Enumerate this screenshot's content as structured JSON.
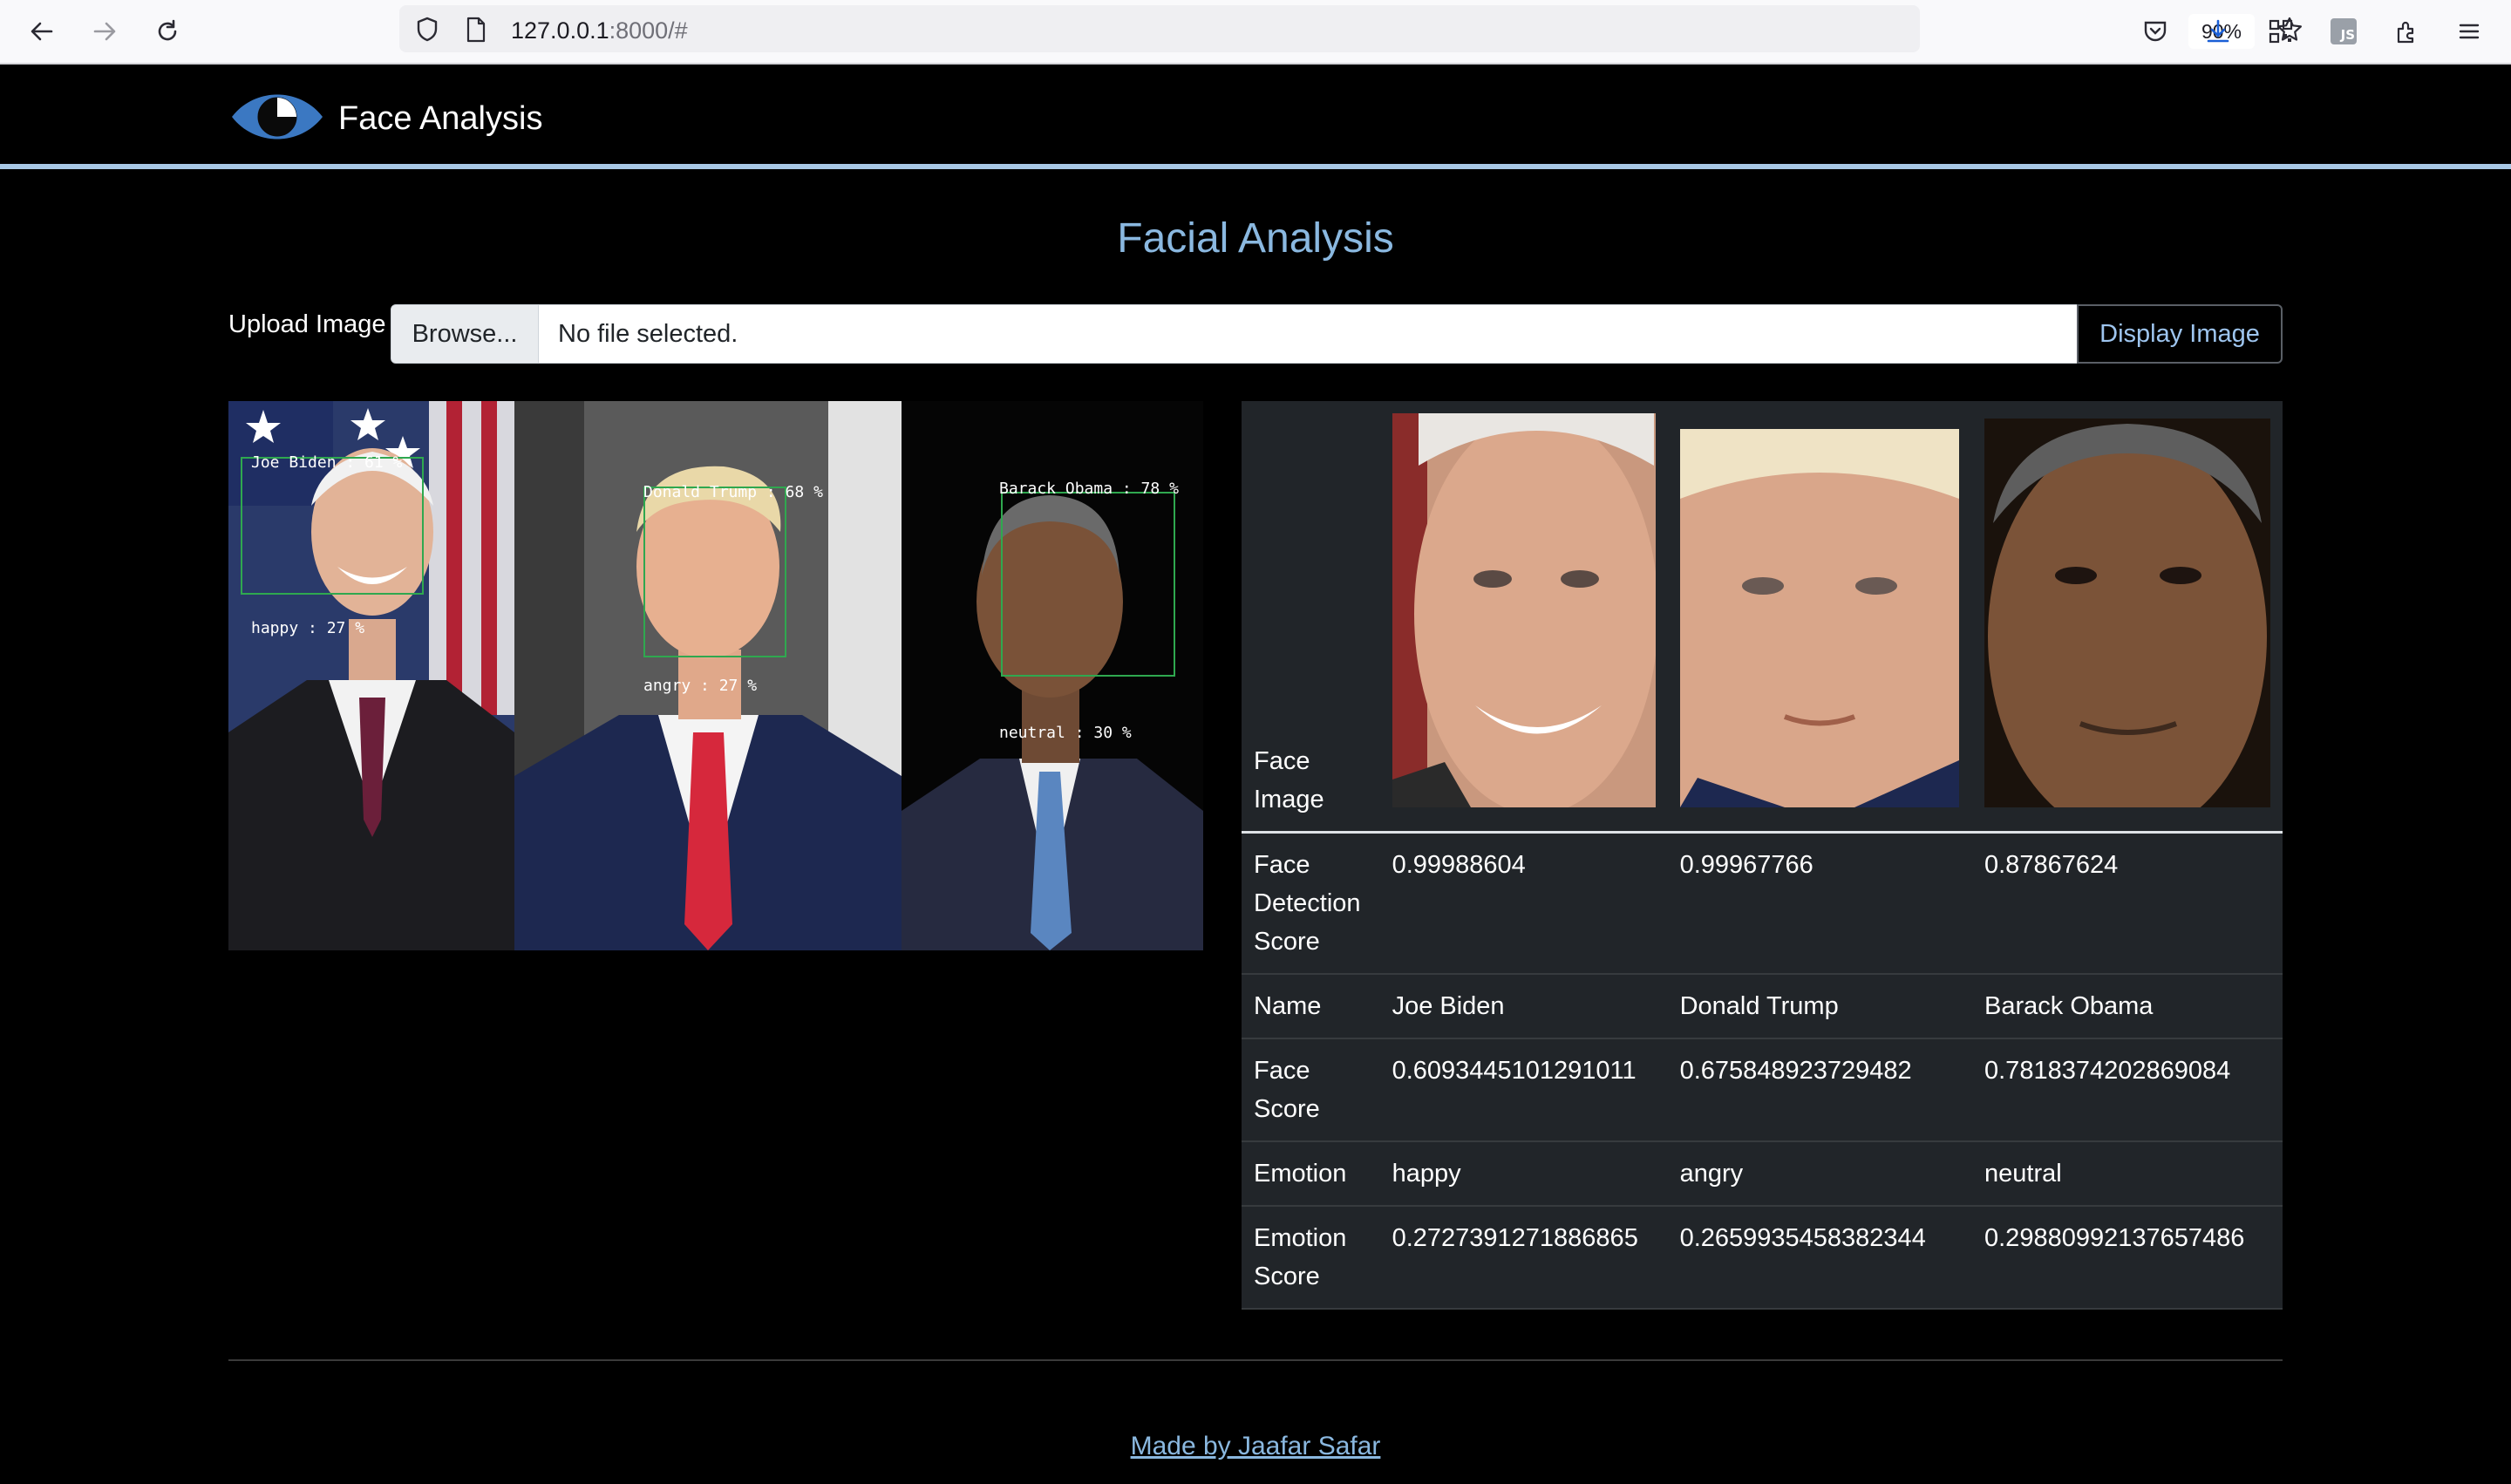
{
  "browser": {
    "url_host": "127.0.0.1",
    "url_rest": ":8000/#",
    "zoom": "90%",
    "icons": [
      "back-arrow-icon",
      "forward-arrow-icon",
      "reload-icon",
      "shield-icon",
      "page-icon",
      "star-icon",
      "pocket-icon",
      "download-icon",
      "qr-code-icon",
      "js-icon",
      "extensions-icon",
      "menu-icon"
    ]
  },
  "navbar": {
    "brand": "Face Analysis",
    "logo_icon": "eye-icon"
  },
  "main": {
    "title": "Facial Analysis",
    "upload_label": "Upload Image",
    "browse_label": "Browse...",
    "file_status": "No file selected.",
    "display_button": "Display Image"
  },
  "analysis_image": {
    "labels": [
      {
        "name": "Joe Biden : 61 %",
        "emotion": "happy : 27 %"
      },
      {
        "name": "Donald Trump : 68 %",
        "emotion": "angry : 27 %"
      },
      {
        "name": "Barack Obama : 78 %",
        "emotion": "neutral : 30 %"
      }
    ]
  },
  "results": {
    "row_headers": {
      "face_image": "Face Image",
      "detection": "Face Detection Score",
      "name": "Name",
      "face_score": "Face Score",
      "emotion": "Emotion",
      "emotion_score": "Emotion Score"
    },
    "faces": [
      {
        "detection": "0.99988604",
        "name": "Joe Biden",
        "face_score": "0.6093445101291011",
        "emotion": "happy",
        "emotion_score": "0.2727391271886865"
      },
      {
        "detection": "0.99967766",
        "name": "Donald Trump",
        "face_score": "0.675848923729482",
        "emotion": "angry",
        "emotion_score": "0.2659935458382344"
      },
      {
        "detection": "0.87867624",
        "name": "Barack Obama",
        "face_score": "0.7818374202869084",
        "emotion": "neutral",
        "emotion_score": "0.29880992137657486"
      }
    ]
  },
  "footer": {
    "link": "Made by Jaafar Safar"
  }
}
